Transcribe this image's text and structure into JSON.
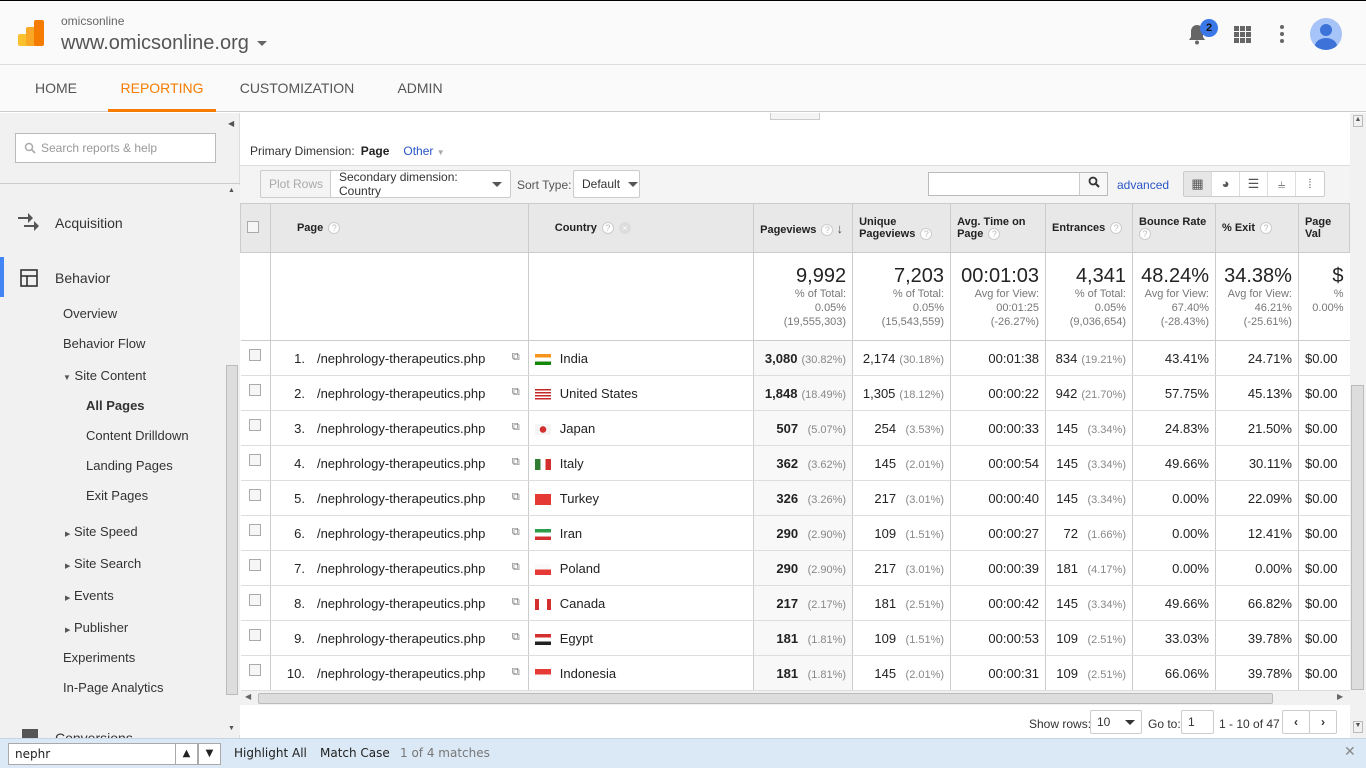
{
  "header": {
    "account": "omicsonline",
    "property": "www.omicsonline.org",
    "notification_count": "2"
  },
  "nav": {
    "tabs": [
      {
        "label": "Home",
        "active": false
      },
      {
        "label": "Reporting",
        "active": true
      },
      {
        "label": "Customization",
        "active": false
      },
      {
        "label": "Admin",
        "active": false
      }
    ]
  },
  "sidebar": {
    "search_placeholder": "Search reports & help",
    "items": {
      "acquisition": "Acquisition",
      "behavior": "Behavior",
      "overview": "Overview",
      "behavior_flow": "Behavior Flow",
      "site_content": "Site Content",
      "all_pages": "All Pages",
      "content_drilldown": "Content Drilldown",
      "landing_pages": "Landing Pages",
      "exit_pages": "Exit Pages",
      "site_speed": "Site Speed",
      "site_search": "Site Search",
      "events": "Events",
      "publisher": "Publisher",
      "experiments": "Experiments",
      "in_page_analytics": "In-Page Analytics",
      "conversions": "Conversions"
    }
  },
  "report": {
    "primary_dimension_label": "Primary Dimension:",
    "primary_dimension_value": "Page",
    "other_label": "Other",
    "plot_rows": "Plot Rows",
    "secondary_dimension": "Secondary dimension: Country",
    "sort_type_label": "Sort Type:",
    "sort_type_value": "Default",
    "search_value": "",
    "advanced": "advanced",
    "columns": {
      "page": "Page",
      "country": "Country",
      "pageviews": "Pageviews",
      "unique_pageviews": "Unique Pageviews",
      "avg_time": "Avg. Time on Page",
      "entrances": "Entrances",
      "bounce_rate": "Bounce Rate",
      "exit": "% Exit",
      "page_value": "Page Val"
    },
    "totals": {
      "pageviews": {
        "value": "9,992",
        "l1": "% of Total:",
        "l2": "0.05%",
        "l3": "(19,555,303)"
      },
      "unique_pageviews": {
        "value": "7,203",
        "l1": "% of Total:",
        "l2": "0.05%",
        "l3": "(15,543,559)"
      },
      "avg_time": {
        "value": "00:01:03",
        "l1": "Avg for View:",
        "l2": "00:01:25",
        "l3": "(-26.27%)"
      },
      "entrances": {
        "value": "4,341",
        "l1": "% of Total:",
        "l2": "0.05%",
        "l3": "(9,036,654)"
      },
      "bounce_rate": {
        "value": "48.24%",
        "l1": "Avg for View:",
        "l2": "67.40%",
        "l3": "(-28.43%)"
      },
      "exit": {
        "value": "34.38%",
        "l1": "Avg for View:",
        "l2": "46.21%",
        "l3": "(-25.61%)"
      },
      "page_value": {
        "value": "$",
        "l1": "%",
        "l2": "0.00%",
        "l3": ""
      }
    },
    "rows": [
      {
        "n": "1.",
        "page": "/nephrology-therapeutics.php",
        "country": "India",
        "pv": "3,080",
        "pvp": "(30.82%)",
        "upv": "2,174",
        "upvp": "(30.18%)",
        "time": "00:01:38",
        "ent": "834",
        "entp": "(19.21%)",
        "br": "43.41%",
        "exit": "24.71%",
        "val": "$0.00"
      },
      {
        "n": "2.",
        "page": "/nephrology-therapeutics.php",
        "country": "United States",
        "pv": "1,848",
        "pvp": "(18.49%)",
        "upv": "1,305",
        "upvp": "(18.12%)",
        "time": "00:00:22",
        "ent": "942",
        "entp": "(21.70%)",
        "br": "57.75%",
        "exit": "45.13%",
        "val": "$0.00"
      },
      {
        "n": "3.",
        "page": "/nephrology-therapeutics.php",
        "country": "Japan",
        "pv": "507",
        "pvp": "(5.07%)",
        "upv": "254",
        "upvp": "(3.53%)",
        "time": "00:00:33",
        "ent": "145",
        "entp": "(3.34%)",
        "br": "24.83%",
        "exit": "21.50%",
        "val": "$0.00"
      },
      {
        "n": "4.",
        "page": "/nephrology-therapeutics.php",
        "country": "Italy",
        "pv": "362",
        "pvp": "(3.62%)",
        "upv": "145",
        "upvp": "(2.01%)",
        "time": "00:00:54",
        "ent": "145",
        "entp": "(3.34%)",
        "br": "49.66%",
        "exit": "30.11%",
        "val": "$0.00"
      },
      {
        "n": "5.",
        "page": "/nephrology-therapeutics.php",
        "country": "Turkey",
        "pv": "326",
        "pvp": "(3.26%)",
        "upv": "217",
        "upvp": "(3.01%)",
        "time": "00:00:40",
        "ent": "145",
        "entp": "(3.34%)",
        "br": "0.00%",
        "exit": "22.09%",
        "val": "$0.00"
      },
      {
        "n": "6.",
        "page": "/nephrology-therapeutics.php",
        "country": "Iran",
        "pv": "290",
        "pvp": "(2.90%)",
        "upv": "109",
        "upvp": "(1.51%)",
        "time": "00:00:27",
        "ent": "72",
        "entp": "(1.66%)",
        "br": "0.00%",
        "exit": "12.41%",
        "val": "$0.00"
      },
      {
        "n": "7.",
        "page": "/nephrology-therapeutics.php",
        "country": "Poland",
        "pv": "290",
        "pvp": "(2.90%)",
        "upv": "217",
        "upvp": "(3.01%)",
        "time": "00:00:39",
        "ent": "181",
        "entp": "(4.17%)",
        "br": "0.00%",
        "exit": "0.00%",
        "val": "$0.00"
      },
      {
        "n": "8.",
        "page": "/nephrology-therapeutics.php",
        "country": "Canada",
        "pv": "217",
        "pvp": "(2.17%)",
        "upv": "181",
        "upvp": "(2.51%)",
        "time": "00:00:42",
        "ent": "145",
        "entp": "(3.34%)",
        "br": "49.66%",
        "exit": "66.82%",
        "val": "$0.00"
      },
      {
        "n": "9.",
        "page": "/nephrology-therapeutics.php",
        "country": "Egypt",
        "pv": "181",
        "pvp": "(1.81%)",
        "upv": "109",
        "upvp": "(1.51%)",
        "time": "00:00:53",
        "ent": "109",
        "entp": "(2.51%)",
        "br": "33.03%",
        "exit": "39.78%",
        "val": "$0.00"
      },
      {
        "n": "10.",
        "page": "/nephrology-therapeutics.php",
        "country": "Indonesia",
        "pv": "181",
        "pvp": "(1.81%)",
        "upv": "145",
        "upvp": "(2.01%)",
        "time": "00:00:31",
        "ent": "109",
        "entp": "(2.51%)",
        "br": "66.06%",
        "exit": "39.78%",
        "val": "$0.00"
      }
    ],
    "pager": {
      "show_rows_label": "Show rows:",
      "show_rows_value": "10",
      "goto_label": "Go to:",
      "goto_value": "1",
      "range": "1 - 10 of 47"
    }
  },
  "findbar": {
    "query": "nephr",
    "highlight_all": "Highlight All",
    "match_case": "Match Case",
    "matches": "1 of 4 matches"
  }
}
